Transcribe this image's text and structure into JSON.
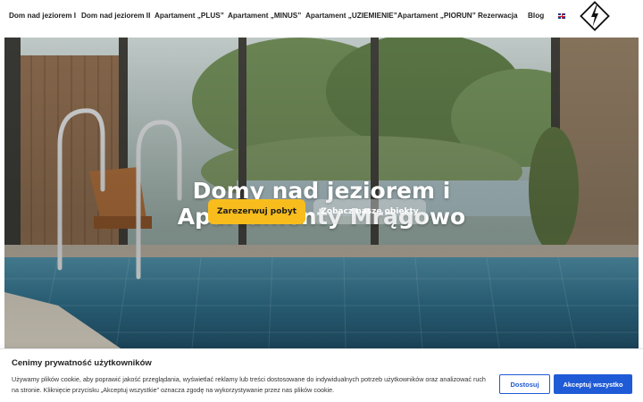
{
  "nav": {
    "items": [
      {
        "label": "Dom nad jeziorem I"
      },
      {
        "label": "Dom nad jeziorem II"
      },
      {
        "label": "Apartament „PLUS”"
      },
      {
        "label": "Apartament „MINUS”"
      },
      {
        "label": "Apartament „UZIEMIENIE”"
      },
      {
        "label": "Apartament „PIORUN”"
      },
      {
        "label": "Rezerwacja"
      },
      {
        "label": "Blog"
      }
    ],
    "language_icon": "uk-flag-icon",
    "logo_icon": "lightning-bolt-diamond-icon"
  },
  "hero": {
    "title_line1": "Domy nad jeziorem i",
    "title_line2": "Apartamenty Mrągowo",
    "primary_button": "Zarezerwuj pobyt",
    "secondary_button": "Zobacz nasze obiekty"
  },
  "cookie": {
    "title": "Cenimy prywatność użytkowników",
    "text": "Używamy plików cookie, aby poprawić jakość przeglądania, wyświetlać reklamy lub treści dostosowane do indywidualnych potrzeb użytkowników oraz analizować ruch na stronie. Kliknięcie przycisku „Akceptuj wszystkie” oznacza zgodę na wykorzystywanie przez nas plików cookie.",
    "customize_label": "Dostosuj",
    "accept_label": "Akceptuj wszystko"
  },
  "colors": {
    "primary_button": "#f8bd1d",
    "accept_button": "#1f5bd6"
  }
}
